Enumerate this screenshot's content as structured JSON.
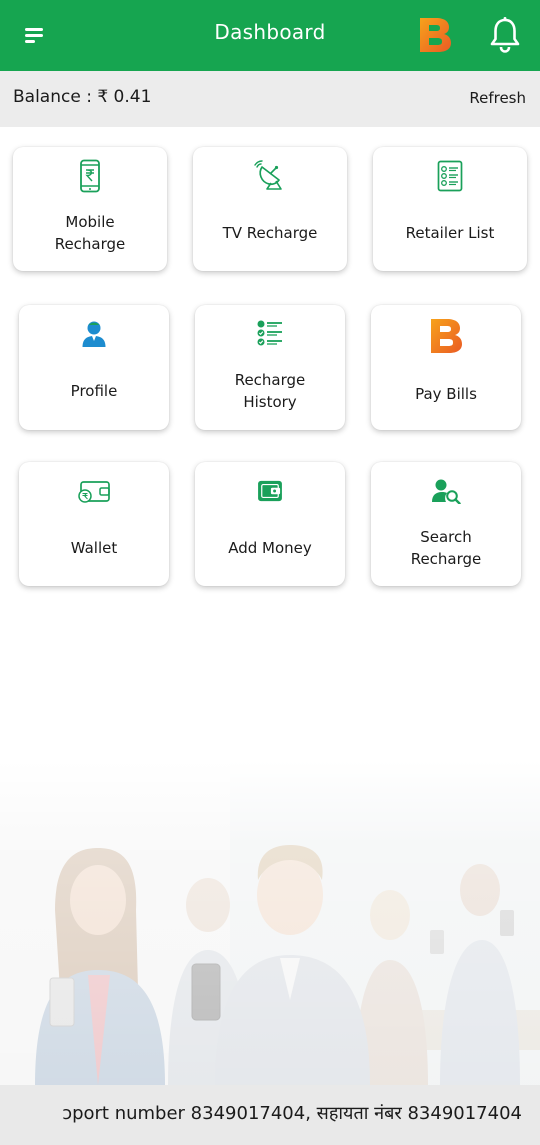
{
  "header": {
    "title": "Dashboard",
    "logo_letter": "B",
    "bg_color": "#16a550",
    "icons": [
      "menu-icon",
      "brand-logo-icon",
      "bell-icon"
    ]
  },
  "balance": {
    "label": "Balance : ₹ 0.41",
    "refresh_label": "Refresh"
  },
  "tiles": [
    {
      "label": "Mobile Recharge",
      "icon": "mobile-rupee-icon"
    },
    {
      "label": "TV Recharge",
      "icon": "satellite-dish-icon"
    },
    {
      "label": "Retailer List",
      "icon": "list-document-icon"
    },
    {
      "label": "Profile",
      "icon": "user-profile-icon"
    },
    {
      "label": "Recharge History",
      "icon": "checklist-icon"
    },
    {
      "label": "Pay Bills",
      "icon": "brand-b-icon"
    },
    {
      "label": "Wallet",
      "icon": "wallet-icon"
    },
    {
      "label": "Add Money",
      "icon": "add-money-wallet-icon"
    },
    {
      "label": "Search Recharge",
      "icon": "user-search-icon"
    }
  ],
  "support_marquee": "ɔport number 8349017404, सहायता नंबर 8349017404",
  "colors": {
    "primary_green": "#16a550",
    "icon_green": "#1aa05a",
    "brand_orange": "#f07a1f",
    "profile_blue": "#1d8ccf"
  }
}
